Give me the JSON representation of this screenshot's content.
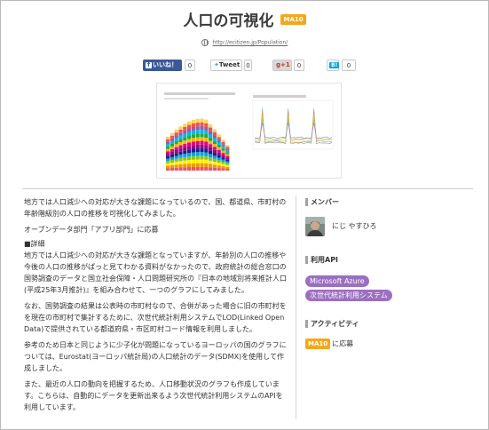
{
  "header": {
    "title": "人口の可視化",
    "badge": "MA10",
    "url": "http://ecitizen.jp/Population/"
  },
  "share": {
    "facebook_label": "いいね！",
    "facebook_count": "0",
    "twitter_label": "Tweet",
    "twitter_count": "0",
    "googleplus_label": "g+1",
    "googleplus_count": "0",
    "hatena_label": "B!",
    "hatena_count": "0"
  },
  "body": {
    "paragraphs": [
      "地方では人口減少への対応が大きな課題になっているので、国、都道県、市町村の年齢階級別の人口の推移を可視化してみました。",
      "オープンデータ部門「アプリ部門」に応募",
      "■詳細",
      "地方では人口減少への対応が大きな課題となっていますが、年齢別の人口の推移や今後の人口の推移がぱっと見てわかる資料がなかったので、政府統計の総合窓口の国勢調査のデータと国立社会保障・人口問題研究所の『日本の地域別将来推計人口(平成25年3月推計)』を組み合わせて、一つのグラフにしてみました。",
      "なお、国勢調査の結果は公表時の市町村なので、合併があった場合に旧の市町村をを現在の市町村で集計するために、次世代統計利用システムでLOD(Linked Open Data)で提供されている都道府県・市区町村コード情報を利用しました。",
      "参考のため日本と同じように少子化が問題になっているヨーロッパの国のグラフについては、Eurostat(ヨーロッパ統計局)の人口統計のデータ(SDMX)を使用して作成しました。",
      "また、最近の人口の動向を把握するため、人口移動状況のグラフも作成しています。こちらは、自動的にデータを更新出来るよう次世代統計利用システムのAPIを利用しています。"
    ]
  },
  "sidebar": {
    "member_heading": "メンバー",
    "member_name": "にじ やすひろ",
    "api_heading": "利用API",
    "api_tags": [
      "Microsoft Azure",
      "次世代統計利用システム"
    ],
    "activity_heading": "アクティビティ",
    "activity_badge": "MA10",
    "activity_label": "に応募"
  },
  "colors": {
    "badge": "#f3a81d",
    "tag": "#9b6fc0",
    "facebook": "#3b5998"
  }
}
